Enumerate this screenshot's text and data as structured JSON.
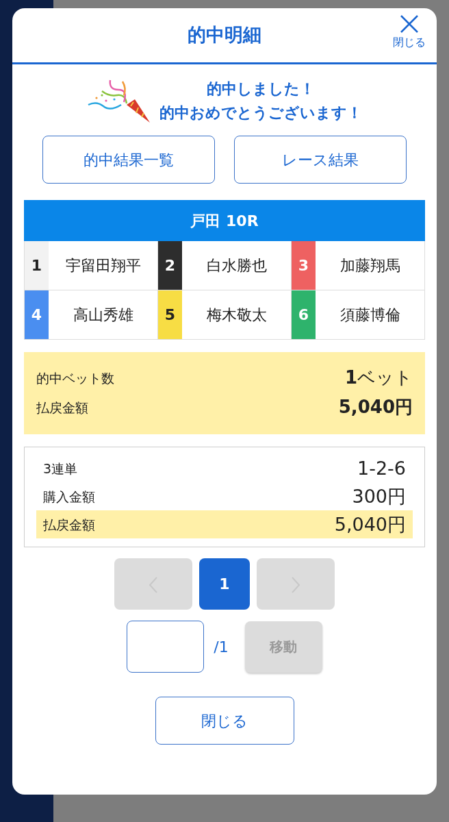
{
  "modal": {
    "title": "的中明細",
    "close_label": "閉じる"
  },
  "message": {
    "lines": [
      "的中しました！",
      "的中おめでとうございます！"
    ]
  },
  "links": [
    "的中結果一覧",
    "レース結果"
  ],
  "race": {
    "title": "戸田 10R",
    "racers": [
      {
        "number": "1",
        "name": "宇留田翔平",
        "color": "#f2f2f2"
      },
      {
        "number": "2",
        "name": "白水勝也",
        "color": "#2d2d2d"
      },
      {
        "number": "3",
        "name": "加藤翔馬",
        "color": "#ee6161"
      },
      {
        "number": "4",
        "name": "高山秀雄",
        "color": "#4a8ef0"
      },
      {
        "number": "5",
        "name": "梅木敬太",
        "color": "#f7dd44"
      },
      {
        "number": "6",
        "name": "須藤博倫",
        "color": "#2eb36c"
      }
    ]
  },
  "summary": [
    {
      "label": "的中ベット数",
      "value": "**1**ベット"
    },
    {
      "label": "払戻金額",
      "value": "5,040円"
    }
  ],
  "bet": {
    "rows": [
      {
        "label": "3連単",
        "value": "1-2-6",
        "highlighted": false
      },
      {
        "label": "購入金額",
        "value": "300円",
        "highlighted": false
      },
      {
        "label": "払戻金額",
        "value": "5,040円",
        "highlighted": true
      }
    ]
  },
  "pagination": {
    "prev_disabled": true,
    "next_disabled": true,
    "pages": [
      {
        "label": "1",
        "selected": true
      }
    ]
  },
  "jump": {
    "total": "/1",
    "button": "移動",
    "disabled": true
  },
  "close_button": "閉じる"
}
